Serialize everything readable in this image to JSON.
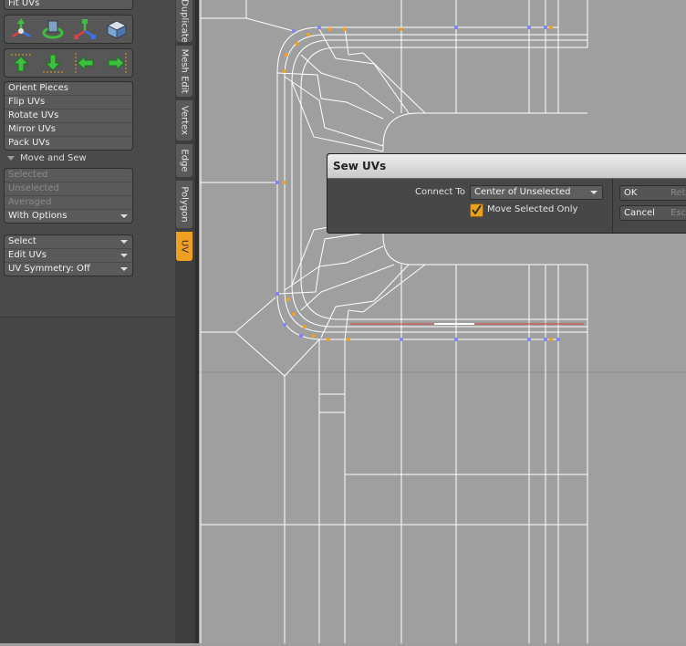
{
  "panel": {
    "top_row_label": "Fit UVs",
    "ops": [
      "Orient Pieces",
      "Flip UVs",
      "Rotate UVs",
      "Mirror UVs",
      "Pack UVs"
    ],
    "move_sew_title": "Move and Sew",
    "sew_modes": [
      "Selected",
      "Unselected",
      "Averaged"
    ],
    "with_options": "With Options",
    "dropdowns": [
      "Select",
      "Edit UVs",
      "UV Symmetry: Off"
    ]
  },
  "tabs": [
    "Duplicate",
    "Mesh Edit",
    "Vertex",
    "Edge",
    "Polygon",
    "UV"
  ],
  "dialog": {
    "title": "Sew UVs",
    "connect_label": "Connect To",
    "connect_value": "Center of Unselected",
    "move_selected_label": "Move Selected Only",
    "move_selected_checked": true,
    "ok_label": "OK",
    "ok_hint": "Ret",
    "cancel_label": "Cancel",
    "cancel_hint": "Esc"
  },
  "colors": {
    "accent": "#f0a020",
    "panel_bg": "#474747",
    "viewport_bg": "#9f9f9f",
    "wire": "#ffffff",
    "vertex_blue": "#8080ff",
    "vertex_orange": "#f0a020",
    "seam_red": "#d04040"
  }
}
